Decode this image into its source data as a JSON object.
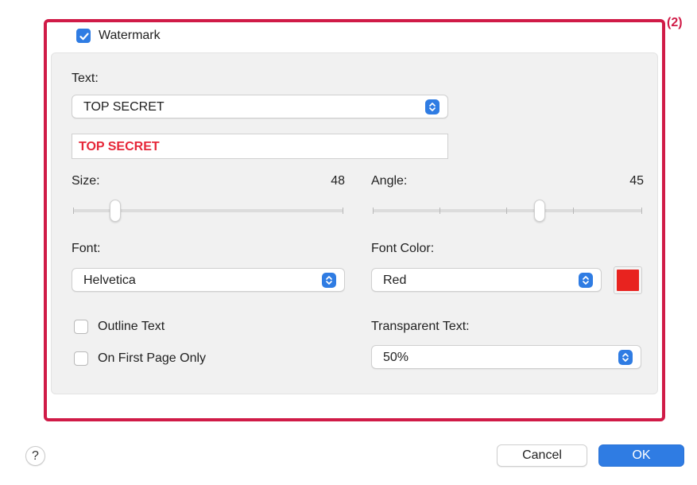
{
  "callout": "(2)",
  "watermark": {
    "label": "Watermark",
    "checked": true
  },
  "text_section": {
    "label": "Text:",
    "preset_value": "TOP SECRET",
    "field_value": "TOP SECRET",
    "field_color": "#e62739"
  },
  "size": {
    "label": "Size:",
    "value": "48"
  },
  "angle": {
    "label": "Angle:",
    "value": "45"
  },
  "font": {
    "label": "Font:",
    "value": "Helvetica"
  },
  "font_color": {
    "label": "Font Color:",
    "value": "Red",
    "swatch": "#e8231f"
  },
  "outline_text": {
    "label": "Outline Text",
    "checked": false
  },
  "first_page_only": {
    "label": "On First Page Only",
    "checked": false
  },
  "transparent_text": {
    "label": "Transparent Text:",
    "value": "50%"
  },
  "buttons": {
    "help": "?",
    "cancel": "Cancel",
    "ok": "OK"
  },
  "colors": {
    "accent": "#2f7ce3",
    "annotation": "#d01b47"
  }
}
